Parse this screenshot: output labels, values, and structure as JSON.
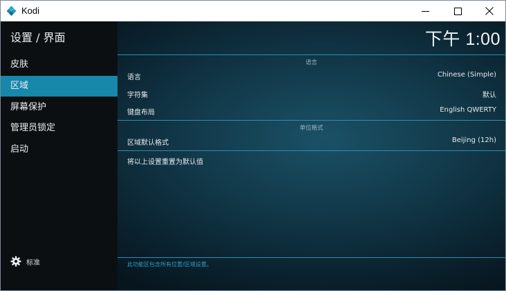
{
  "window": {
    "app_title": "Kodi",
    "brand_color": "#1787aa"
  },
  "sidebar": {
    "header": "设置 / 界面",
    "items": [
      {
        "label": "皮肤",
        "active": false
      },
      {
        "label": "区域",
        "active": true
      },
      {
        "label": "屏幕保护",
        "active": false
      },
      {
        "label": "管理员锁定",
        "active": false
      },
      {
        "label": "启动",
        "active": false
      }
    ],
    "footer_label": "标准",
    "footer_icon": "gear-icon"
  },
  "main": {
    "clock": "下午 1:00",
    "sections": [
      {
        "title": "语言",
        "rows": [
          {
            "label": "语言",
            "value": "Chinese (Simple)"
          },
          {
            "label": "字符集",
            "value": "默认"
          },
          {
            "label": "键盘布局",
            "value": "English QWERTY"
          }
        ]
      },
      {
        "title": "单位格式",
        "rows": [
          {
            "label": "区域默认格式",
            "value": "Beijing (12h)"
          }
        ]
      }
    ],
    "reset_label": "将以上设置重置为默认值",
    "hint": "此功能区包含所有位置/区域设置。"
  }
}
